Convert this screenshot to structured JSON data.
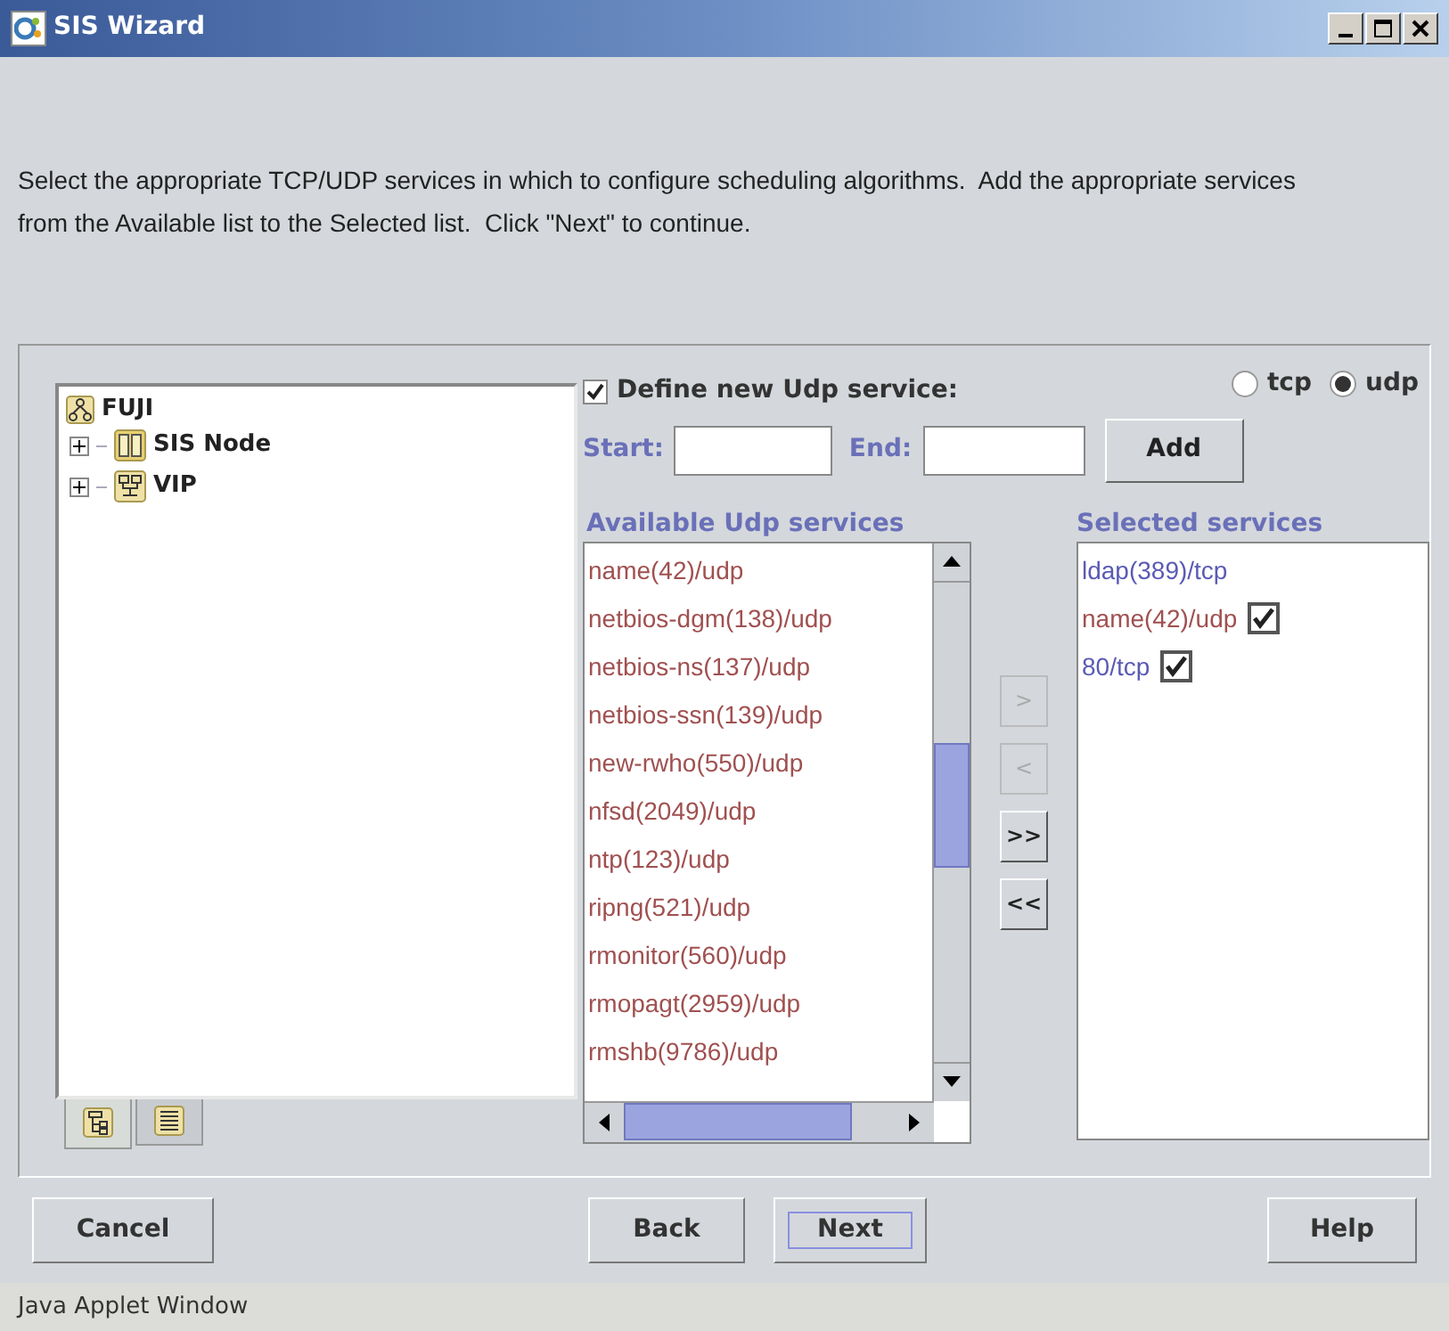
{
  "window": {
    "title": "SIS Wizard"
  },
  "instructions": "Select the appropriate TCP/UDP services in which to configure scheduling algorithms.  Add the appropriate services from the Available list to the Selected list.  Click \"Next\" to continue.",
  "tree": {
    "label": "FUJI",
    "children": [
      {
        "label": "SIS Node",
        "kind": "node",
        "expanded": false
      },
      {
        "label": "VIP",
        "kind": "vip",
        "expanded": false
      }
    ]
  },
  "tree_tabs": [
    {
      "kind": "tree",
      "selected": true
    },
    {
      "kind": "list",
      "selected": false
    }
  ],
  "define": {
    "label": "Define new Udp service:",
    "checked": true
  },
  "protocols": [
    {
      "label": "tcp",
      "selected": false
    },
    {
      "label": "udp",
      "selected": true
    }
  ],
  "start": {
    "label": "Start:"
  },
  "end": {
    "label": "End:"
  },
  "add_button": "Add",
  "available": {
    "title": "Available Udp services",
    "items": [
      "name(42)/udp",
      "netbios-dgm(138)/udp",
      "netbios-ns(137)/udp",
      "netbios-ssn(139)/udp",
      "new-rwho(550)/udp",
      "nfsd(2049)/udp",
      "ntp(123)/udp",
      "ripng(521)/udp",
      "rmonitor(560)/udp",
      "rmopagt(2959)/udp",
      "rmshb(9786)/udp"
    ]
  },
  "move_buttons": [
    {
      "label": ">",
      "disabled": true
    },
    {
      "label": "<",
      "disabled": true
    },
    {
      "label": ">>",
      "disabled": false
    },
    {
      "label": "<<",
      "disabled": false
    }
  ],
  "selected": {
    "title": "Selected services",
    "items": [
      {
        "label": "ldap(389)/tcp",
        "kind": "plain",
        "color": "#5a5ab4"
      },
      {
        "label": "name(42)/udp",
        "kind": "check",
        "checked": true,
        "color": "#a05050"
      },
      {
        "label": "80/tcp",
        "kind": "check",
        "checked": true,
        "color": "#5a5ab4"
      }
    ]
  },
  "buttons": [
    {
      "label": "Cancel",
      "focused": false
    },
    {
      "label": "Back",
      "focused": false
    },
    {
      "label": "Next",
      "focused": true
    },
    {
      "label": "Help",
      "focused": false
    }
  ],
  "status_bar": "Java Applet Window"
}
